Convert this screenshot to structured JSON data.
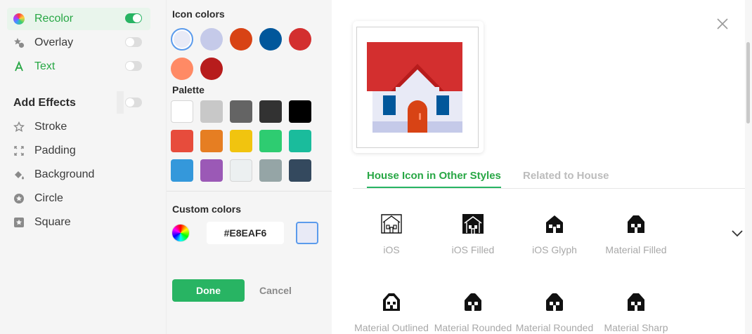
{
  "effects": {
    "items": [
      {
        "label": "Recolor",
        "icon": "color-wheel-icon",
        "toggle": true,
        "active": true
      },
      {
        "label": "Overlay",
        "icon": "overlay-icon",
        "toggle": false
      },
      {
        "label": "Text",
        "icon": "text-icon",
        "toggle": false
      }
    ],
    "add_effects_label": "Add Effects",
    "add_items": [
      {
        "label": "Stroke",
        "icon": "star-outline-icon"
      },
      {
        "label": "Padding",
        "icon": "expand-arrows-icon"
      },
      {
        "label": "Background",
        "icon": "paint-bucket-icon"
      },
      {
        "label": "Circle",
        "icon": "star-circle-icon"
      },
      {
        "label": "Square",
        "icon": "star-square-icon"
      }
    ]
  },
  "colors": {
    "icon_colors_title": "Icon colors",
    "icon_colors": [
      "#E8EAF6",
      "#C5CAE9",
      "#D84315",
      "#01579B",
      "#D32F2F",
      "#FF8A65",
      "#B71C1C"
    ],
    "palette_title": "Palette",
    "palette": [
      "#FFFFFF",
      "#C8C8C8",
      "#646464",
      "#323232",
      "#000000",
      "#E74C3C",
      "#E67E22",
      "#F1C40F",
      "#2ECC71",
      "#1ABC9C",
      "#3498DB",
      "#9B59B6",
      "#ECF0F1",
      "#95A5A6",
      "#34495E"
    ],
    "custom_title": "Custom colors",
    "hex_value": "#E8EAF6",
    "current_swatch": "#E8EAF6"
  },
  "actions": {
    "done": "Done",
    "cancel": "Cancel"
  },
  "tabs": [
    {
      "label": "House Icon in Other Styles",
      "active": true
    },
    {
      "label": "Related to House",
      "active": false
    }
  ],
  "styles": [
    {
      "label": "iOS",
      "icon": "house-outline-icon"
    },
    {
      "label": "iOS Filled",
      "icon": "house-filled-icon"
    },
    {
      "label": "iOS Glyph",
      "icon": "house-glyph-icon"
    },
    {
      "label": "Material Filled",
      "icon": "house-material-filled-icon"
    },
    {
      "label": "Material Outlined",
      "icon": "house-material-outlined-icon"
    },
    {
      "label": "Material Rounded",
      "icon": "house-material-rounded-icon"
    },
    {
      "label": "Material Rounded",
      "icon": "house-material-rounded-icon"
    },
    {
      "label": "Material Sharp",
      "icon": "house-material-sharp-icon"
    }
  ],
  "accent_color": "#28B463"
}
